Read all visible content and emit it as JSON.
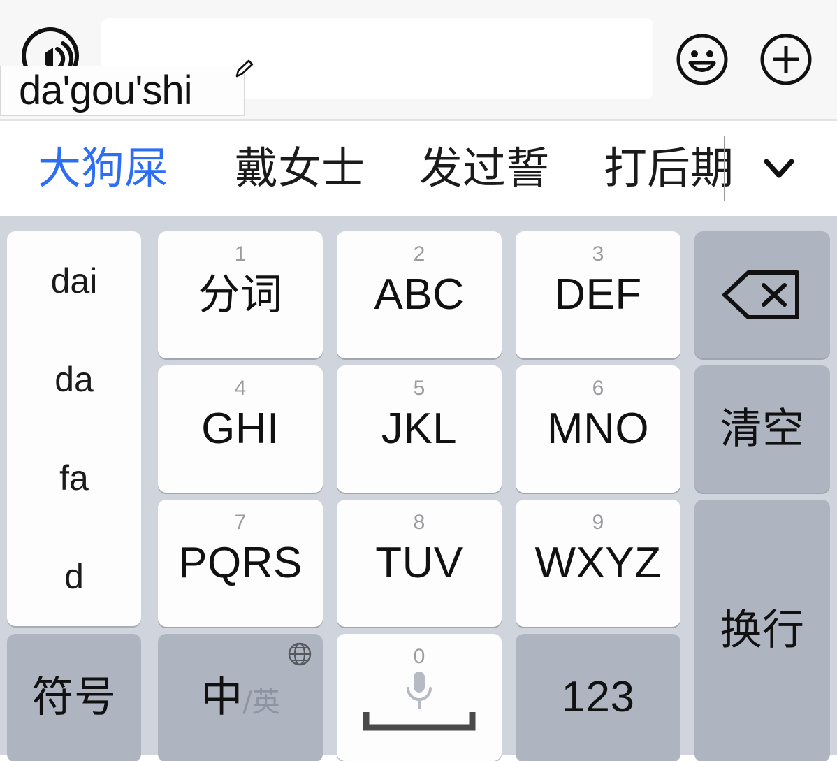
{
  "input_bar": {
    "voice_icon": "voice-wave-icon",
    "composing_text": "da'gou'shi",
    "edit_icon": "pencil-icon",
    "emoji_button_icon": "smiley-face-icon",
    "add_button_icon": "plus-circle-icon",
    "field_placeholder": ""
  },
  "candidate_bar": {
    "candidates": [
      {
        "text": "大狗屎",
        "selected": true
      },
      {
        "text": "戴女士",
        "selected": false
      },
      {
        "text": "发过誓",
        "selected": false
      },
      {
        "text": "打后期",
        "selected": false
      }
    ],
    "expand_icon": "chevron-down-icon",
    "selected_color": "#2d6ef5"
  },
  "keyboard": {
    "background_color": "#d0d4dc",
    "light_key_color": "#fdfdfd",
    "dark_key_color": "#aeb4c0",
    "pinyin_column": {
      "items": [
        "dai",
        "da",
        "fa",
        "d"
      ]
    },
    "keys": [
      {
        "num": "1",
        "label": "分词",
        "type": "cjk"
      },
      {
        "num": "2",
        "label": "ABC",
        "type": "latin"
      },
      {
        "num": "3",
        "label": "DEF",
        "type": "latin"
      },
      {
        "num": "4",
        "label": "GHI",
        "type": "latin"
      },
      {
        "num": "5",
        "label": "JKL",
        "type": "latin"
      },
      {
        "num": "6",
        "label": "MNO",
        "type": "latin"
      },
      {
        "num": "7",
        "label": "PQRS",
        "type": "latin"
      },
      {
        "num": "8",
        "label": "TUV",
        "type": "latin"
      },
      {
        "num": "9",
        "label": "WXYZ",
        "type": "latin"
      }
    ],
    "function_keys": {
      "backspace_icon": "backspace-delete-icon",
      "clear_label": "清空",
      "newline_label": "换行",
      "symbols_label": "符号",
      "lang_zh": "中",
      "lang_sep": "/",
      "lang_en": "英",
      "globe_icon": "globe-icon",
      "numeric_label": "123"
    },
    "space_key": {
      "num": "0",
      "mic_icon": "microphone-icon",
      "space_icon": "space-bar-icon"
    }
  }
}
